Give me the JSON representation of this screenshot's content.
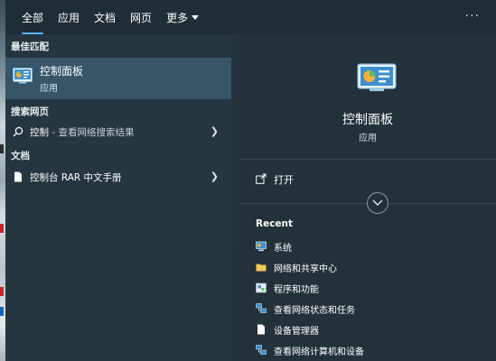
{
  "tabs": [
    {
      "label": "全部"
    },
    {
      "label": "应用"
    },
    {
      "label": "文档"
    },
    {
      "label": "网页"
    },
    {
      "label": "更多"
    }
  ],
  "more_options_label": "···",
  "left": {
    "best_match_label": "最佳匹配",
    "best_match": {
      "title": "控制面板",
      "subtitle": "应用",
      "icon": "control-panel-icon"
    },
    "web_label": "搜索网页",
    "web_result": {
      "query": "控制",
      "suffix": " - 查看网络搜索结果",
      "icon": "search-icon"
    },
    "docs_label": "文档",
    "doc_result": {
      "title": "控制台 RAR 中文手册",
      "icon": "document-icon"
    }
  },
  "right": {
    "title": "控制面板",
    "subtitle": "应用",
    "open_label": "打开",
    "recent_label": "Recent",
    "recent": [
      {
        "label": "系统",
        "icon": "system-icon"
      },
      {
        "label": "网络和共享中心",
        "icon": "folder-icon"
      },
      {
        "label": "程序和功能",
        "icon": "programs-icon"
      },
      {
        "label": "查看网络状态和任务",
        "icon": "network-icon"
      },
      {
        "label": "设备管理器",
        "icon": "document-icon"
      },
      {
        "label": "查看网络计算机和设备",
        "icon": "network-icon"
      }
    ]
  },
  "colors": {
    "accent": "#5db0f5",
    "selected_bg": "#365569"
  }
}
